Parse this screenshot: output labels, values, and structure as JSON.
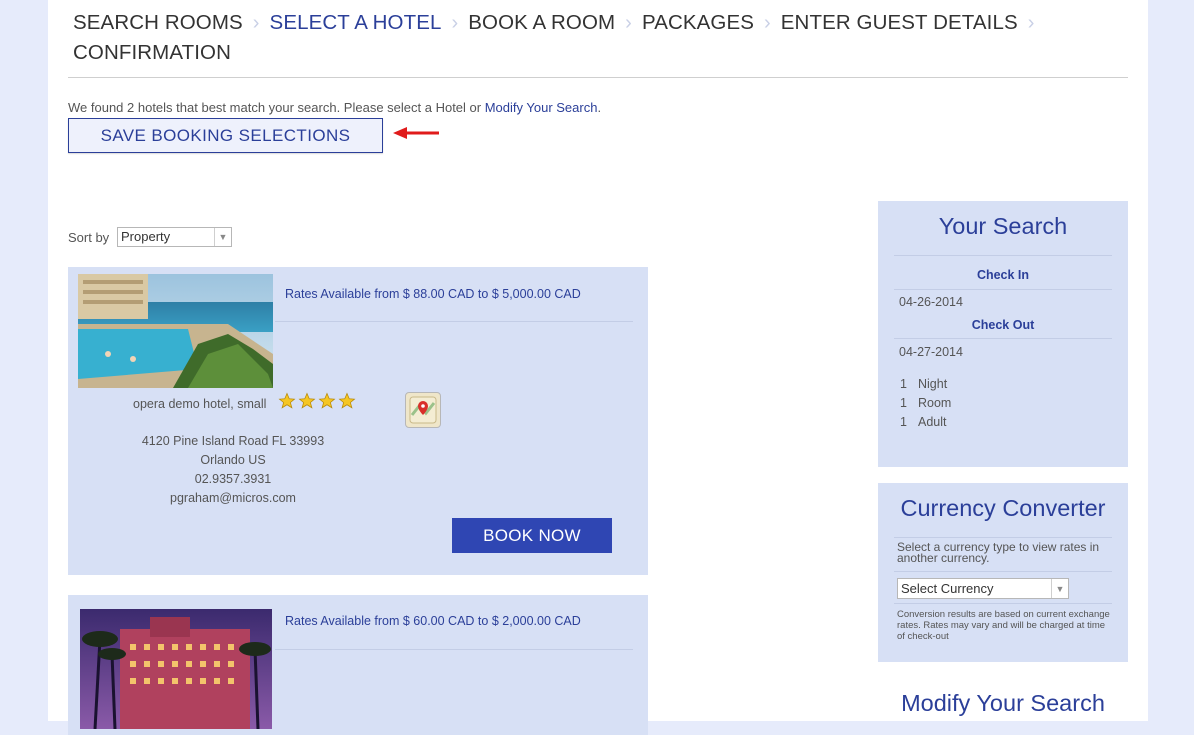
{
  "steps": [
    {
      "label": "SEARCH ROOMS",
      "active": false
    },
    {
      "label": "SELECT A HOTEL",
      "active": true
    },
    {
      "label": "BOOK A ROOM",
      "active": false
    },
    {
      "label": "PACKAGES",
      "active": false
    },
    {
      "label": "ENTER GUEST DETAILS",
      "active": false
    },
    {
      "label": "CONFIRMATION",
      "active": false
    }
  ],
  "results": {
    "found_text": "We found 2 hotels that best match your search. Please select a Hotel or ",
    "modify_link": "Modify Your Search",
    "period": "."
  },
  "save_button": "SAVE BOOKING SELECTIONS",
  "sort": {
    "label": "Sort by",
    "value": "Property"
  },
  "hotels": [
    {
      "rates": "Rates Available from $ 88.00 CAD to $ 5,000.00 CAD",
      "name": "opera demo hotel, small",
      "stars": 4,
      "address": "4120 Pine Island Road FL 33993",
      "city": "Orlando US",
      "phone": "02.9357.3931",
      "email": "pgraham@micros.com",
      "book_label": "BOOK NOW"
    },
    {
      "rates": "Rates Available from $ 60.00 CAD to $ 2,000.00 CAD"
    }
  ],
  "search_panel": {
    "title": "Your Search",
    "checkin_label": "Check In",
    "checkin": "04-26-2014",
    "checkout_label": "Check Out",
    "checkout": "04-27-2014",
    "nights": {
      "n": "1",
      "label": "Night"
    },
    "rooms": {
      "n": "1",
      "label": "Room"
    },
    "adults": {
      "n": "1",
      "label": "Adult"
    }
  },
  "currency_panel": {
    "title": "Currency Converter",
    "desc": "Select a currency type to view rates in another currency.",
    "select": "Select Currency",
    "note": "Conversion results are based on current exchange rates. Rates may vary and will be charged at time of check-out"
  },
  "modify_panel": {
    "title": "Modify Your Search"
  },
  "colors": {
    "accent": "#2b3f99",
    "button": "#2f46b3",
    "panel": "#d7e0f5",
    "arrow": "#e01b1b"
  }
}
